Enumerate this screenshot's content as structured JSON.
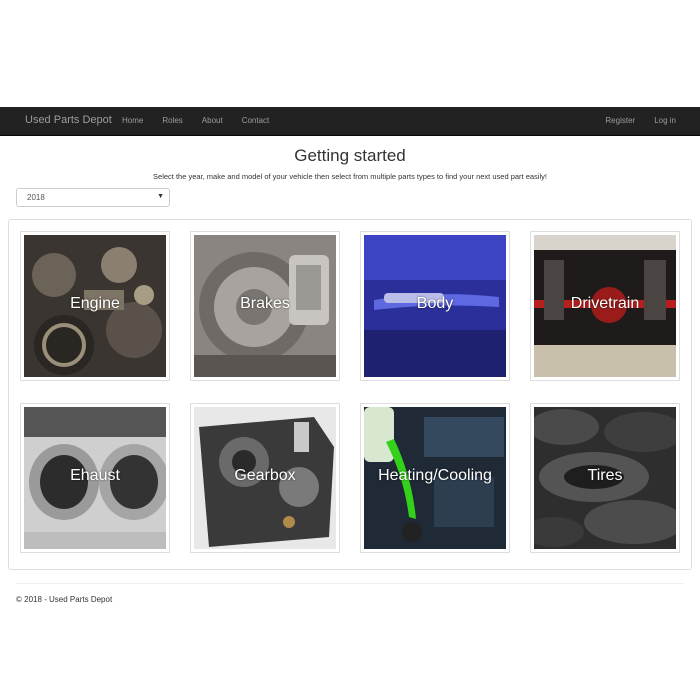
{
  "nav": {
    "brand": "Used Parts Depot",
    "links": [
      "Home",
      "Roles",
      "About",
      "Contact"
    ],
    "right": [
      "Register",
      "Log in"
    ]
  },
  "main": {
    "title": "Getting started",
    "subtitle": "Select the year, make and model of your vehicle then select from multiple parts types to find your next used part easily!",
    "year_select": "2018"
  },
  "categories": [
    "Engine",
    "Brakes",
    "Body",
    "Drivetrain",
    "Ehaust",
    "Gearbox",
    "Heating/Cooling",
    "Tires"
  ],
  "footer": {
    "text": "© 2018 - Used Parts Depot"
  },
  "colors": {
    "navbar": "#222222",
    "nav_text": "#9d9d9d"
  }
}
